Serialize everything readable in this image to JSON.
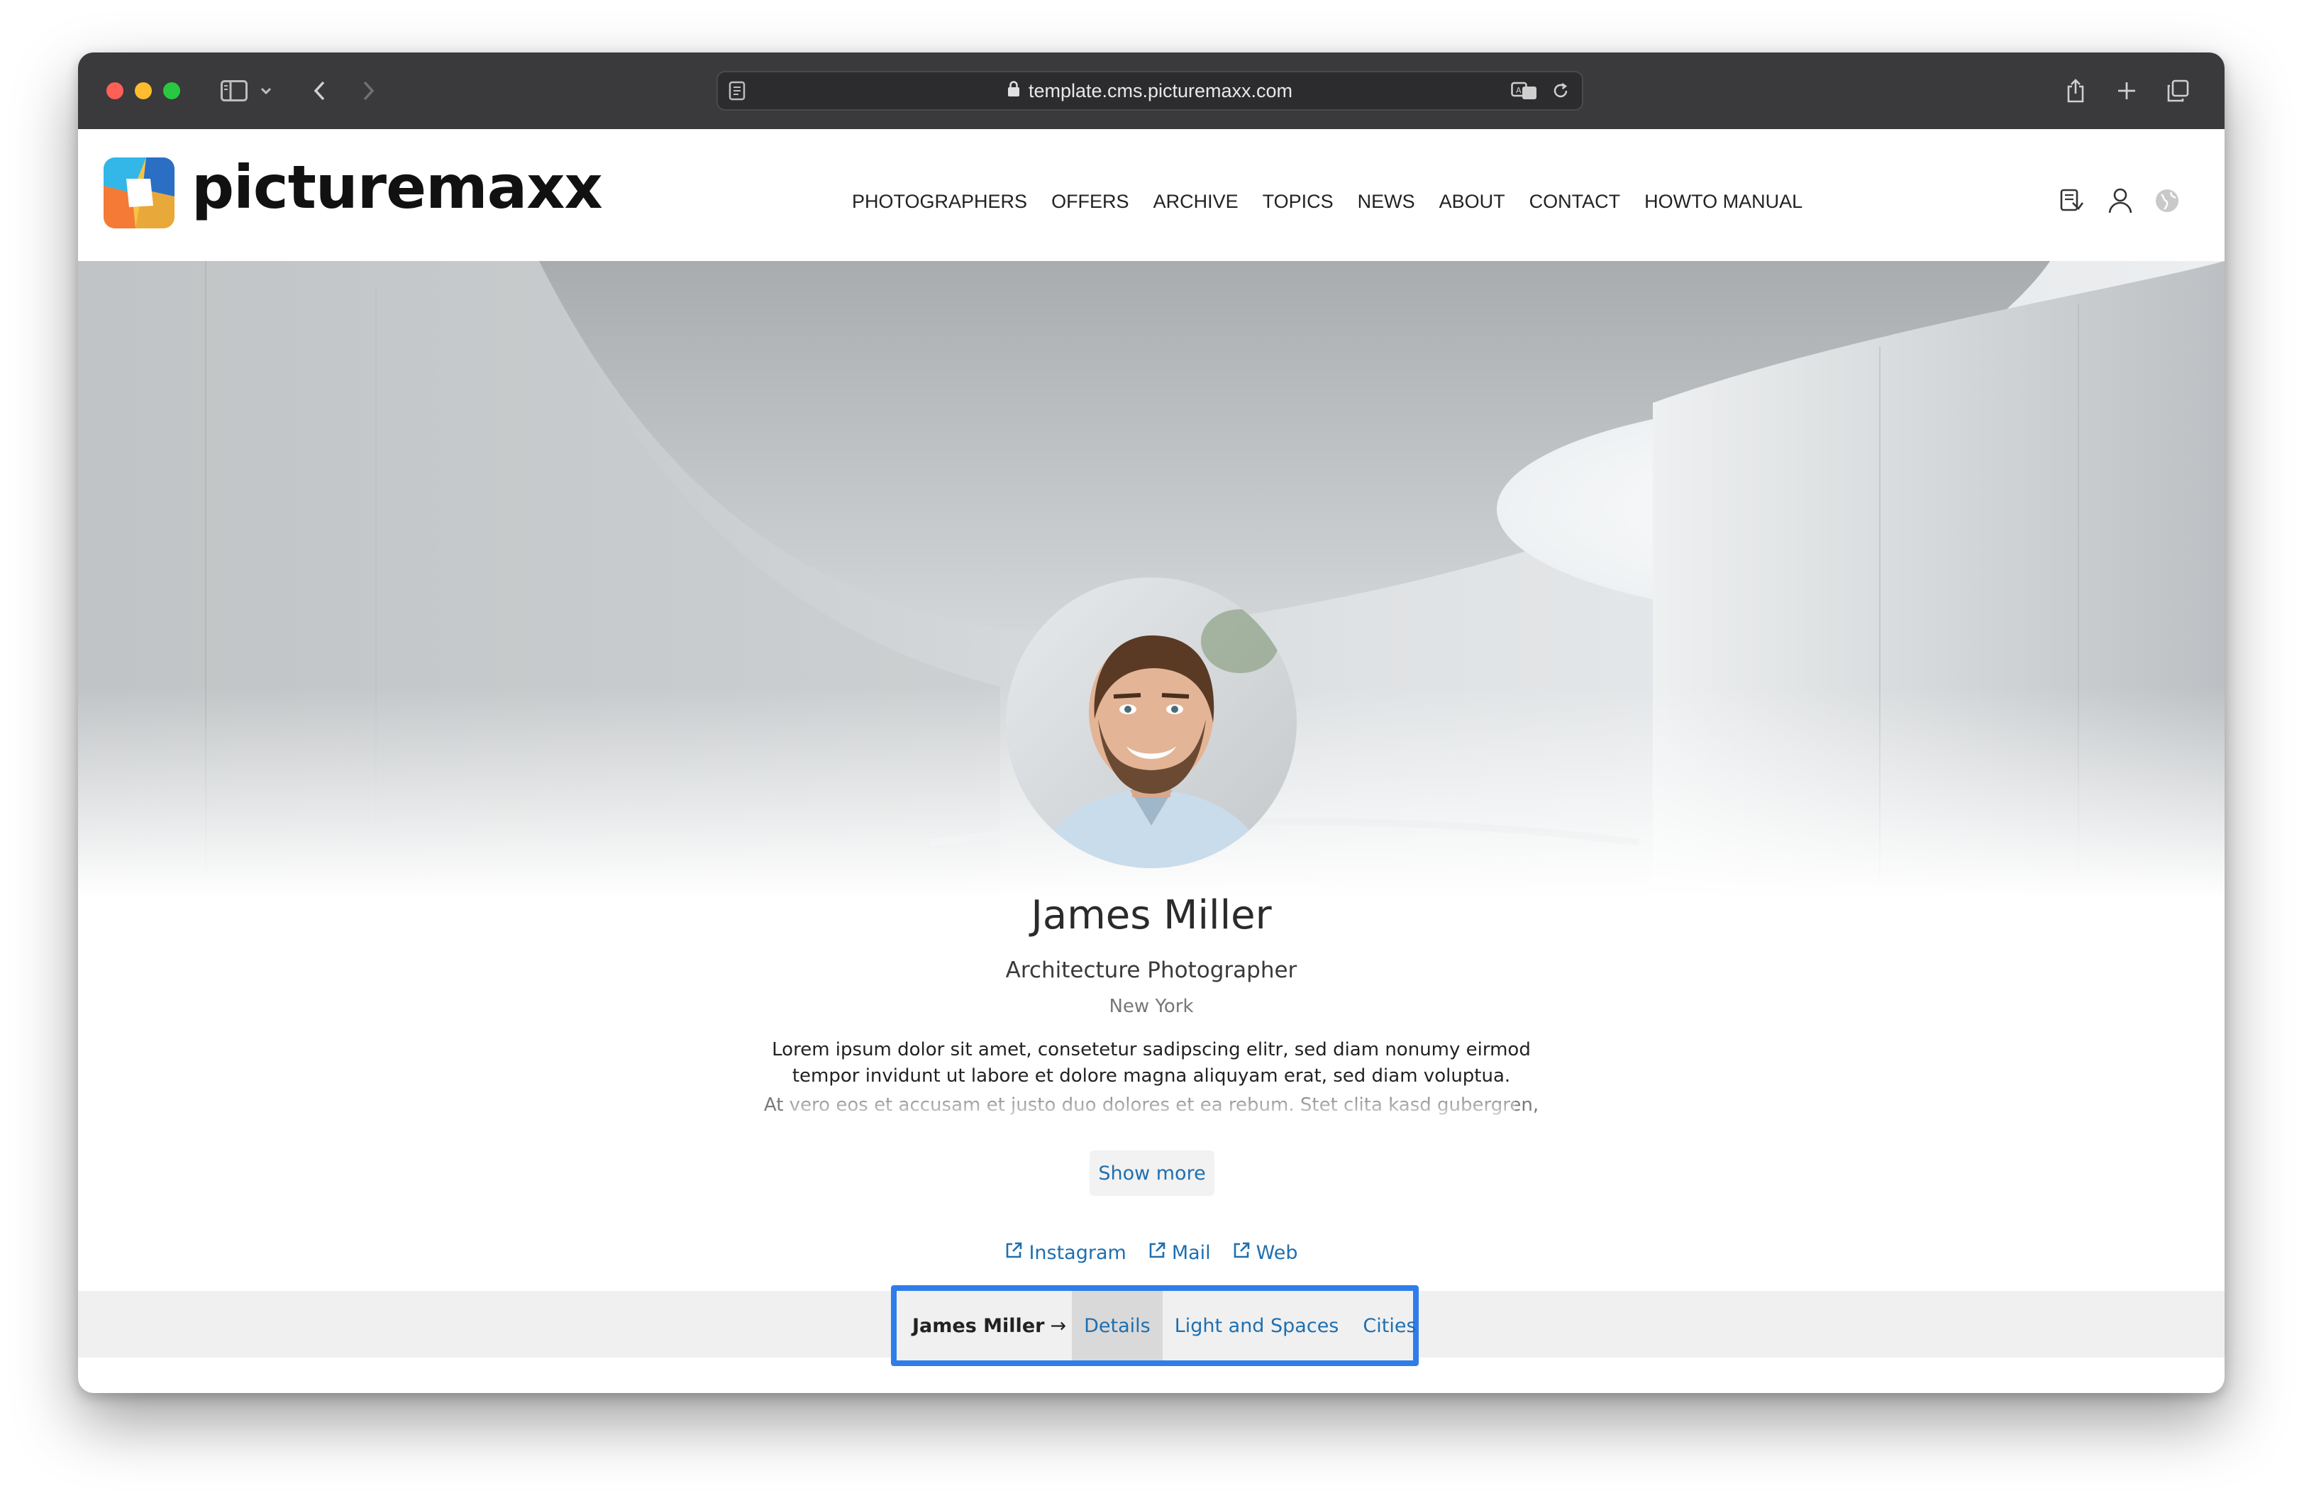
{
  "browser": {
    "url": "template.cms.picturemaxx.com"
  },
  "site": {
    "logo_text": "picturemaxx",
    "nav": [
      {
        "label": "PHOTOGRAPHERS"
      },
      {
        "label": "OFFERS"
      },
      {
        "label": "ARCHIVE"
      },
      {
        "label": "TOPICS"
      },
      {
        "label": "NEWS"
      },
      {
        "label": "ABOUT"
      },
      {
        "label": "CONTACT"
      },
      {
        "label": "HOWTO MANUAL"
      }
    ]
  },
  "profile": {
    "name": "James Miller",
    "role": "Architecture Photographer",
    "city": "New York",
    "bio_line1": "Lorem ipsum dolor sit amet, consetetur sadipscing elitr, sed diam nonumy eirmod",
    "bio_line2": "tempor invidunt ut labore et dolore magna aliquyam erat, sed diam voluptua.",
    "bio_line3": "At vero eos et accusam et justo duo dolores et ea rebum. Stet clita kasd gubergren,",
    "show_more": "Show more",
    "links": [
      {
        "label": "Instagram"
      },
      {
        "label": "Mail"
      },
      {
        "label": "Web"
      }
    ]
  },
  "subnav": {
    "crumb": "James Miller",
    "arrow": "→",
    "tabs": [
      {
        "label": "Details",
        "active": true
      },
      {
        "label": "Light and Spaces",
        "active": false
      },
      {
        "label": "Cities",
        "active": false
      }
    ]
  },
  "colors": {
    "link": "#1e6fb0",
    "highlight_border": "#2f7dea",
    "chrome": "#3a3a3c"
  }
}
